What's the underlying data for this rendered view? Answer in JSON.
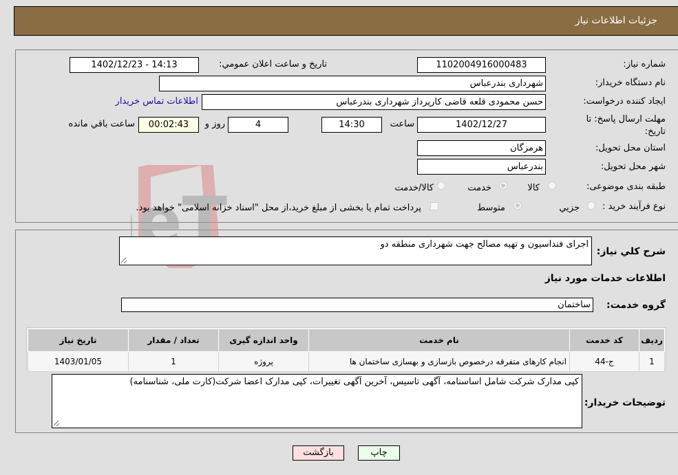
{
  "header": {
    "title": "جزئیات اطلاعات نیاز"
  },
  "fields": {
    "need_number": {
      "label": "شماره نیاز:",
      "value": "1102004916000483"
    },
    "announce_datetime": {
      "label": "تاریخ و ساعت اعلان عمومي:",
      "value": "1402/12/23 - 14:13"
    },
    "buyer_org": {
      "label": "نام دستگاه خریدار:",
      "value": "شهرداری بندرعباس"
    },
    "requester": {
      "label": "ایجاد کننده درخواست:",
      "value": "حسن محمودی قلعه قاضی کارپرداز شهرداری بندرعباس"
    },
    "contact_link": "اطلاعات تماس خریدار",
    "deadline": {
      "label": "مهلت ارسال پاسخ: تا تاریخ:",
      "date": "1402/12/27",
      "time_label": "ساعت",
      "time": "14:30",
      "days": "4",
      "days_label": "روز و",
      "remaining": "00:02:43",
      "remaining_label": "ساعت باقي مانده"
    },
    "province": {
      "label": "استان محل تحویل:",
      "value": "هرمزگان"
    },
    "city": {
      "label": "شهر محل تحویل:",
      "value": "بندرعباس"
    },
    "category": {
      "label": "طبقه بندی موضوعی:",
      "options": [
        "کالا",
        "خدمت",
        "کالا/خدمت"
      ],
      "selected": "خدمت"
    },
    "purchase_type": {
      "label": "نوع فرآیند خرید :",
      "options": [
        "جزيي",
        "متوسط"
      ],
      "selected": "متوسط",
      "treasury_note": "پرداخت تمام یا بخشی از مبلغ خرید،از محل \"اسناد خزانه اسلامی\" خواهد بود."
    }
  },
  "description": {
    "label": "شرح کلي نیاز:",
    "value": "اجرای فنداسیون و تهیه مصالح جهت شهرداری منطقه دو"
  },
  "services_section": {
    "title": "اطلاعات خدمات مورد نیاز"
  },
  "service_group": {
    "label": "گروه خدمت:",
    "value": "ساختمان"
  },
  "table": {
    "headers": [
      "ردیف",
      "کد خدمت",
      "نام خدمت",
      "واحد اندازه گیری",
      "تعداد / مقدار",
      "تاریخ نیاز"
    ],
    "rows": [
      [
        "1",
        "ج-44",
        "انجام کارهای متفرقه درخصوص بازسازی و بهسازی ساختمان ها",
        "پروژه",
        "1",
        "1403/01/05"
      ]
    ]
  },
  "buyer_notes": {
    "label": "توضیحات خریدار:",
    "value": "کپی مدارک شرکت شامل اساسنامه، آگهی تاسیس، آخرین آگهی تغییرات، کپی مدارک اعضا شرکت(کارت ملی، شناسنامه)"
  },
  "buttons": {
    "print": "چاپ",
    "back": "بازگشت"
  },
  "colors": {
    "header_bg": "#8b6d43",
    "print_bg": "#eaffea",
    "back_bg": "#ffe0e0",
    "remaining_bg": "#ffffe6"
  },
  "watermark": "AriaTender.neT"
}
